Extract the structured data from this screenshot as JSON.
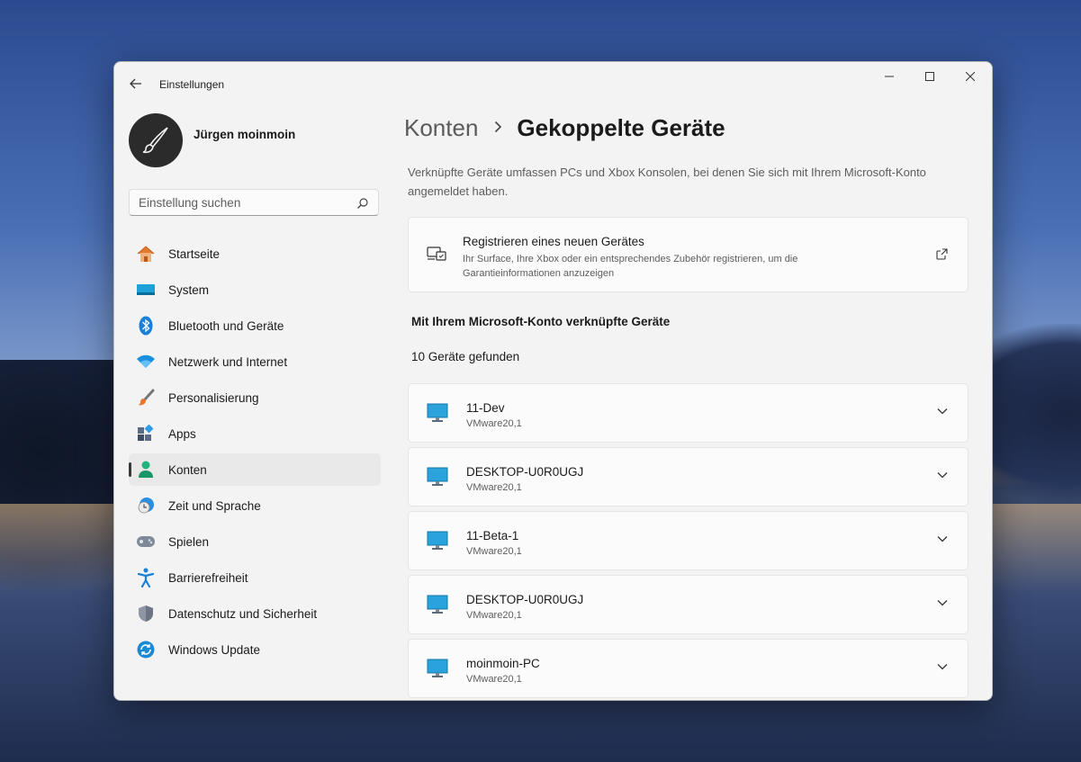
{
  "window": {
    "app_title": "Einstellungen"
  },
  "user": {
    "name": "Jürgen moinmoin"
  },
  "search": {
    "placeholder": "Einstellung suchen"
  },
  "sidebar": {
    "items": [
      {
        "label": "Startseite",
        "icon": "home-icon"
      },
      {
        "label": "System",
        "icon": "system-icon"
      },
      {
        "label": "Bluetooth und Geräte",
        "icon": "bluetooth-icon"
      },
      {
        "label": "Netzwerk und Internet",
        "icon": "wifi-icon"
      },
      {
        "label": "Personalisierung",
        "icon": "brush-icon"
      },
      {
        "label": "Apps",
        "icon": "apps-icon"
      },
      {
        "label": "Konten",
        "icon": "person-icon",
        "active": true
      },
      {
        "label": "Zeit und Sprache",
        "icon": "clock-globe-icon"
      },
      {
        "label": "Spielen",
        "icon": "gamepad-icon"
      },
      {
        "label": "Barrierefreiheit",
        "icon": "accessibility-icon"
      },
      {
        "label": "Datenschutz und Sicherheit",
        "icon": "shield-icon"
      },
      {
        "label": "Windows Update",
        "icon": "update-icon"
      }
    ]
  },
  "main": {
    "breadcrumb_parent": "Konten",
    "breadcrumb_current": "Gekoppelte Geräte",
    "description": "Verknüpfte Geräte umfassen PCs und Xbox Konsolen, bei denen Sie sich mit Ihrem Microsoft-Konto angemeldet haben.",
    "register": {
      "title": "Registrieren eines neuen Gerätes",
      "subtitle": "Ihr Surface, Ihre Xbox oder ein entsprechendes Zubehör registrieren, um die Garantieinformationen anzuzeigen"
    },
    "section_title": "Mit Ihrem Microsoft-Konto verknüpfte Geräte",
    "device_count": "10 Geräte gefunden",
    "devices": [
      {
        "name": "11-Dev",
        "type": "VMware20,1"
      },
      {
        "name": "DESKTOP-U0R0UGJ",
        "type": "VMware20,1"
      },
      {
        "name": "11-Beta-1",
        "type": "VMware20,1"
      },
      {
        "name": "DESKTOP-U0R0UGJ",
        "type": "VMware20,1"
      },
      {
        "name": "moinmoin-PC",
        "type": "VMware20,1"
      }
    ]
  },
  "colors": {
    "accent": "#0067c0",
    "window_bg": "#f3f3f3",
    "card_bg": "#fbfbfb"
  }
}
